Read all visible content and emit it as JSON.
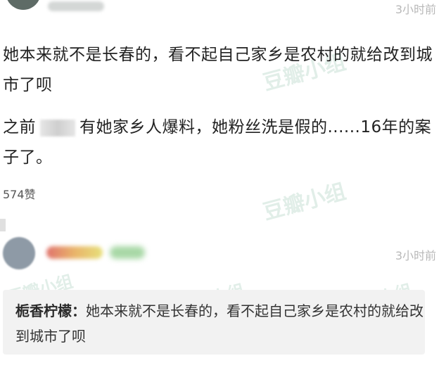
{
  "top_comment": {
    "time": "3小时前",
    "text_line_1": "她本来就不是长春的，看不起自己家乡是农村的就给改到城市了呗",
    "text_line_2_a": "之前",
    "text_line_2_b": "有她家乡人爆料，她粉丝洗是假的......16年的案子了。",
    "likes": "574赞"
  },
  "second_comment": {
    "time": "3小时前",
    "quote_author": "栀香柠檬：",
    "quote_text": "她本来就不是长春的，看不起自己家乡是农村的就给改到城市了呗"
  },
  "watermarks": [
    "豆瓣小组",
    "豆瓣小组",
    "豆瓣小组",
    "豆瓣小组",
    "豆瓣小组"
  ],
  "colors": {
    "time_gray": "#b8b8b8",
    "text_dark": "#222222",
    "quote_bg": "#f2f2f2"
  }
}
